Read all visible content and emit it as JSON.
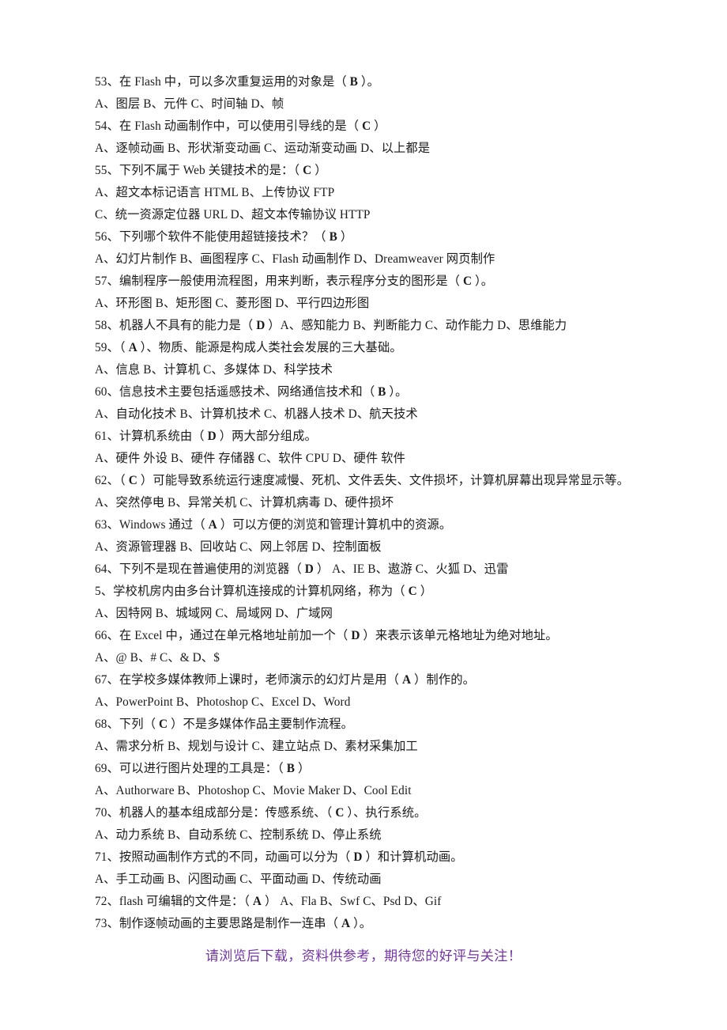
{
  "document": {
    "type": "multiple-choice-question-sheet",
    "language": "zh-CN",
    "text_color": "#1a1a1a",
    "footer_color": "#7434a5",
    "background_color": "#ffffff"
  },
  "lines": [
    {
      "id": "q53",
      "text": "53、在 Flash 中，可以多次重复运用的对象是（  B   ）。"
    },
    {
      "id": "q53o",
      "text": "A、图层      B、元件     C、时间轴     D、帧"
    },
    {
      "id": "q54",
      "text": "54、在 Flash 动画制作中，可以使用引导线的是（  C ）"
    },
    {
      "id": "q54o",
      "text": "A、逐帧动画     B、形状渐变动画   C、运动渐变动画   D、以上都是"
    },
    {
      "id": "q55",
      "text": "55、下列不属于 Web 关键技术的是：（ C  ）"
    },
    {
      "id": "q55o1",
      "text": "A、超文本标记语言 HTML    B、上传协议 FTP"
    },
    {
      "id": "q55o2",
      "text": "C、统一资源定位器 URL     D、超文本传输协议 HTTP"
    },
    {
      "id": "q56",
      "text": "56、下列哪个软件不能使用超链接技术？（   B   ）"
    },
    {
      "id": "q56o",
      "text": "A、幻灯片制作  B、画图程序  C、Flash 动画制作   D、Dreamweaver 网页制作"
    },
    {
      "id": "q57",
      "text": "57、编制程序一般使用流程图，用来判断，表示程序分支的图形是（  C ）。"
    },
    {
      "id": "q57o",
      "text": "A、环形图     B、矩形图    C、菱形图     D、平行四边形图"
    },
    {
      "id": "q58",
      "text": "58、机器人不具有的能力是（ D ）A、感知能力  B、判断能力  C、动作能力  D、思维能力"
    },
    {
      "id": "q59",
      "text": "59、（  A ）、物质、能源是构成人类社会发展的三大基础。"
    },
    {
      "id": "q59o",
      "text": "A、信息   B、计算机   C、多媒体   D、科学技术"
    },
    {
      "id": "q60",
      "text": "60、信息技术主要包括遥感技术、网络通信技术和（  B   ）。"
    },
    {
      "id": "q60o",
      "text": "A、自动化技术   B、计算机技术   C、机器人技术   D、航天技术"
    },
    {
      "id": "q61",
      "text": "61、计算机系统由（  D ）两大部分组成。"
    },
    {
      "id": "q61o",
      "text": "A、硬件  外设   B、硬件  存储器   C、软件  CPU   D、硬件  软件"
    },
    {
      "id": "q62",
      "text": "62、（ C ）可能导致系统运行速度减慢、死机、文件丢失、文件损坏，计算机屏幕出现异常显示等。 A、突然停电    B、异常关机   C、计算机病毒   D、硬件损坏"
    },
    {
      "id": "q63",
      "text": "63、Windows 通过（  A ）可以方便的浏览和管理计算机中的资源。"
    },
    {
      "id": "q63o",
      "text": "A、资源管理器    B、回收站   C、网上邻居    D、控制面板"
    },
    {
      "id": "q64",
      "text": "64、下列不是现在普遍使用的浏览器（ D ） A、IE  B、遨游   C、火狐   D、迅雷"
    },
    {
      "id": "q65",
      "text": "5、学校机房内由多台计算机连接成的计算机网络，称为（ C  ）"
    },
    {
      "id": "q65o",
      "text": "A、因特网    B、城域网    C、局域网    D、广域网"
    },
    {
      "id": "q66",
      "text": "66、在 Excel 中，通过在单元格地址前加一个（ D ）来表示该单元格地址为绝对地址。"
    },
    {
      "id": "q66o",
      "text": "A、@    B、#   C、&   D、$"
    },
    {
      "id": "q67",
      "text": "67、在学校多媒体教师上课时，老师演示的幻灯片是用（  A ）制作的。"
    },
    {
      "id": "q67o",
      "text": "A、PowerPoint   B、Photoshop    C、Excel   D、Word"
    },
    {
      "id": "q68",
      "text": "68、下列（ C ）不是多媒体作品主要制作流程。"
    },
    {
      "id": "q68o",
      "text": "A、需求分析    B、规划与设计    C、建立站点   D、素材采集加工"
    },
    {
      "id": "q69",
      "text": "69、可以进行图片处理的工具是：（ B ）"
    },
    {
      "id": "q69o",
      "text": "A、Authorware    B、Photoshop   C、Movie Maker   D、Cool Edit"
    },
    {
      "id": "q70",
      "text": "70、机器人的基本组成部分是：传感系统、（ C ）、执行系统。"
    },
    {
      "id": "q70o",
      "text": "A、动力系统    B、自动系统    C、控制系统    D、停止系统"
    },
    {
      "id": "q71",
      "text": "71、按照动画制作方式的不同，动画可以分为（ D  ）和计算机动画。"
    },
    {
      "id": "q71o",
      "text": "A、手工动画    B、闪图动画    C、平面动画    D、传统动画"
    },
    {
      "id": "q72",
      "text": "72、flash 可编辑的文件是：（  A  ） A、Fla    B、Swf    C、Psd    D、Gif"
    },
    {
      "id": "q73",
      "text": "73、制作逐帧动画的主要思路是制作一连串（ A  ）。"
    }
  ],
  "answer_keys": {
    "q53": "B",
    "q54": "C",
    "q55": "C",
    "q56": "B",
    "q57": "C",
    "q58": "D",
    "q59": "A",
    "q60": "B",
    "q61": "D",
    "q62": "C",
    "q63": "A",
    "q64": "D",
    "q65": "C",
    "q66": "D",
    "q67": "A",
    "q68": "C",
    "q69": "B",
    "q70": "C",
    "q71": "D",
    "q72": "A",
    "q73": "A"
  },
  "footer": {
    "text": "请浏览后下载，资料供参考，期待您的好评与关注！"
  }
}
